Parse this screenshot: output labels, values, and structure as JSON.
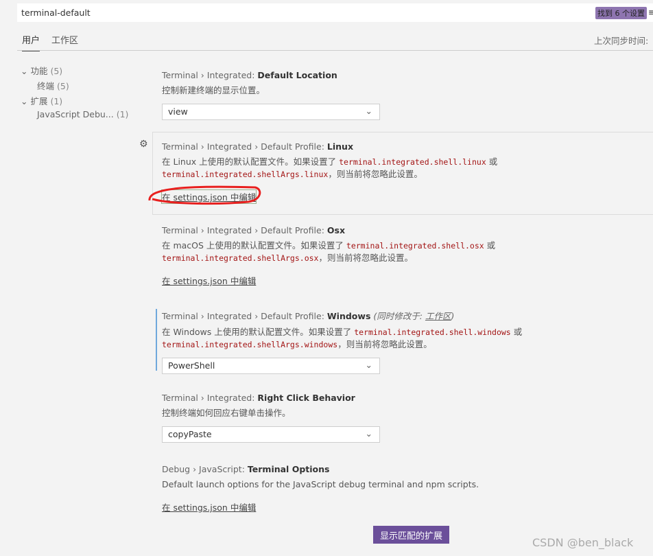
{
  "search": {
    "value": "terminal-default",
    "badge": "找到 6 个设置",
    "menu_icon": "list-filter-icon"
  },
  "tabs": [
    {
      "label": "用户"
    },
    {
      "label": "工作区"
    }
  ],
  "sync_label": "上次同步时间: ",
  "tree": [
    {
      "label": "功能",
      "count": "(5)",
      "expanded": true
    },
    {
      "label": "终端",
      "count": "(5)"
    },
    {
      "label": "扩展",
      "count": "(1)",
      "expanded": true
    },
    {
      "label": "JavaScript Debu...",
      "count": "(1)"
    }
  ],
  "settings": [
    {
      "prefix": "Terminal › Integrated: ",
      "name": "Default Location",
      "desc": "控制新建终端的显示位置。",
      "select": "view"
    },
    {
      "prefix": "Terminal › Integrated › Default Profile: ",
      "name": "Linux",
      "desc1": "在 Linux 上使用的默认配置文件。如果设置了 ",
      "code1": "terminal.integrated.shell.linux",
      "or": " 或",
      "code2": "terminal.integrated.shellArgs.linux",
      "desc2": "，则当前将忽略此设置。",
      "link": "在 settings.json 中编辑"
    },
    {
      "prefix": "Terminal › Integrated › Default Profile: ",
      "name": "Osx",
      "desc1": "在 macOS 上使用的默认配置文件。如果设置了 ",
      "code1": "terminal.integrated.shell.osx",
      "or": " 或",
      "code2": "terminal.integrated.shellArgs.osx",
      "desc2": "，则当前将忽略此设置。",
      "link": "在 settings.json 中编辑"
    },
    {
      "prefix": "Terminal › Integrated › Default Profile: ",
      "name": "Windows",
      "modified": "(同时修改于: ",
      "modified_link": "工作区",
      "modified_end": ")",
      "desc1": "在 Windows 上使用的默认配置文件。如果设置了 ",
      "code1": "terminal.integrated.shell.windows",
      "or": " 或",
      "code2": "terminal.integrated.shellArgs.windows",
      "desc2": "，则当前将忽略此设置。",
      "select": "PowerShell"
    },
    {
      "prefix": "Terminal › Integrated: ",
      "name": "Right Click Behavior",
      "desc": "控制终端如何回应右键单击操作。",
      "select": "copyPaste"
    },
    {
      "prefix": "Debug › JavaScript: ",
      "name": "Terminal Options",
      "desc": "Default launch options for the JavaScript debug terminal and npm scripts.",
      "link": "在 settings.json 中编辑"
    }
  ],
  "button": "显示匹配的扩展",
  "watermark": "CSDN @ben_black",
  "colors": {
    "accent": "#6b4f9a",
    "code": "#a31515",
    "annotation": "#e8201f",
    "modified_bar": "#6fa8dc"
  }
}
